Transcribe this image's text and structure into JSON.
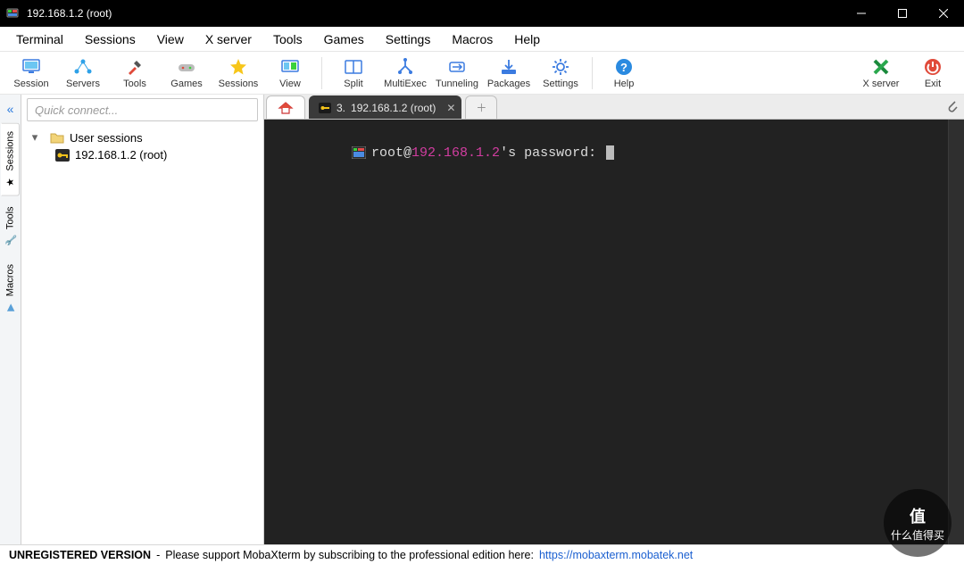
{
  "window": {
    "title": "192.168.1.2 (root)"
  },
  "menubar": [
    "Terminal",
    "Sessions",
    "View",
    "X server",
    "Tools",
    "Games",
    "Settings",
    "Macros",
    "Help"
  ],
  "toolbar": {
    "groups": [
      [
        "Session",
        "Servers",
        "Tools",
        "Games",
        "Sessions",
        "View"
      ],
      [
        "Split",
        "MultiExec",
        "Tunneling",
        "Packages",
        "Settings"
      ],
      [
        "Help"
      ]
    ],
    "right": [
      "X server",
      "Exit"
    ]
  },
  "sidebar": {
    "quick_connect_placeholder": "Quick connect...",
    "tabs": [
      "Sessions",
      "Tools",
      "Macros"
    ],
    "active_tab": 0,
    "tree": {
      "root_label": "User sessions",
      "items": [
        {
          "label": "192.168.1.2 (root)"
        }
      ]
    }
  },
  "tabs": {
    "home_label": "",
    "active": {
      "index_label": "3.",
      "title": "192.168.1.2 (root)"
    },
    "new_label": "+"
  },
  "terminal": {
    "prompt_user": "root",
    "host": "192.168.1.2",
    "prompt_tail": "'s password:"
  },
  "statusbar": {
    "unregistered": "UNREGISTERED VERSION",
    "sep": "-",
    "message": "Please support MobaXterm by subscribing to the professional edition here:",
    "link_text": "https://mobaxterm.mobatek.net"
  },
  "watermark": "什么值得买"
}
